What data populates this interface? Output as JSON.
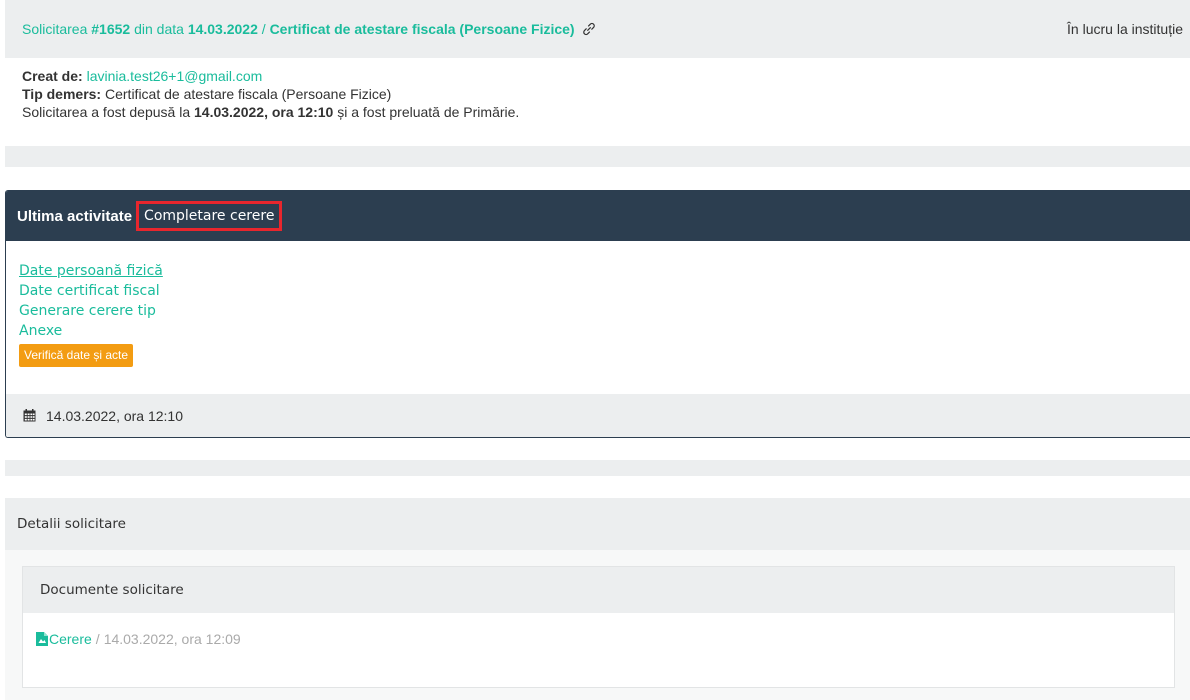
{
  "request": {
    "prefix": "Solicitarea",
    "number": "#1652",
    "date_prefix": "din data",
    "date": "14.03.2022",
    "separator": "/",
    "type_title": "Certificat de atestare fiscala (Persoane Fizice)",
    "status": "În lucru la instituție",
    "created_by_label": "Creat de:",
    "created_by_email": "lavinia.test26+1@gmail.com",
    "type_label": "Tip demers:",
    "type_value": "Certificat de atestare fiscala (Persoane Fizice)",
    "submitted_prefix": "Solicitarea a fost depusă la",
    "submitted_at": "14.03.2022, ora 12:10",
    "submitted_suffix": "și a fost preluată de Primărie."
  },
  "activity": {
    "title": "Ultima activitate",
    "value": "Completare cerere",
    "links": [
      "Date persoană fizică",
      "Date certificat fiscal",
      "Generare cerere tip",
      "Anexe"
    ],
    "button_label": "Verifică date și acte",
    "timestamp": "14.03.2022, ora 12:10"
  },
  "details": {
    "title": "Detalii solicitare",
    "documents_title": "Documente solicitare",
    "document_name": "Cerere",
    "document_separator": "/",
    "document_date": "14.03.2022, ora 12:09"
  },
  "colors": {
    "accent": "#1abc9c",
    "dark_header": "#2c3e50",
    "button": "#f39c12",
    "highlight_border": "#e8262d"
  },
  "icons": {
    "link": "link-icon",
    "calendar": "calendar-icon",
    "file": "file-icon"
  }
}
